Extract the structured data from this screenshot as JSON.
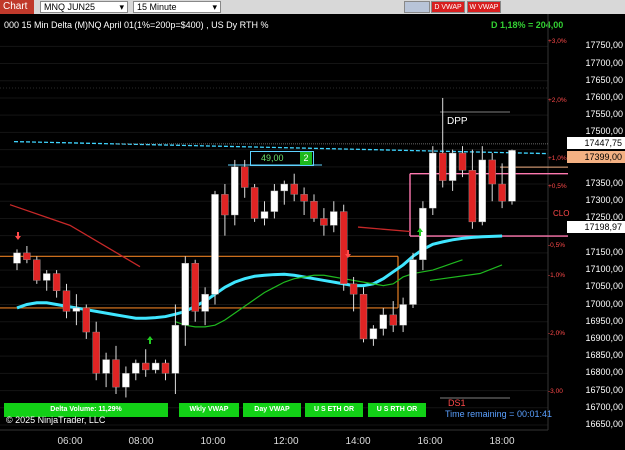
{
  "toolbar": {
    "chart_tab": "Chart",
    "instrument": "MNQ JUN25",
    "interval": "15 Minute",
    "btn_d_vwap": "D VWAP",
    "btn_w_vwap": "W VWAP",
    "colors": {
      "tab": "#c0392b",
      "toolbar_bg": "#d8d8d8"
    }
  },
  "header": {
    "title": "000 15 Min Delta (M)NQ  April 01(1%=200p=$400) , US Dy RTH %",
    "delta_stat": "D 1,18% = 204,00"
  },
  "price_axis": {
    "labels": [
      "17750,00",
      "17700,00",
      "17650,00",
      "17600,00",
      "17550,00",
      "17500,00",
      "17350,00",
      "17300,00",
      "17250,00",
      "17150,00",
      "17100,00",
      "17050,00",
      "17000,00",
      "16950,00",
      "16900,00",
      "16850,00",
      "16800,00",
      "16750,00",
      "16700,00",
      "16650,00"
    ],
    "pct_labels": [
      "+3,0%",
      "+2,0%",
      "+1,0%",
      "+0,5%",
      "-0,5%",
      "-1,0%",
      "-2,0%",
      "-3,00"
    ],
    "badge_last": "17447,75",
    "badge_prev": "17399,00",
    "badge_low": "17198,97"
  },
  "time_axis": {
    "labels": [
      "06:00",
      "08:00",
      "10:00",
      "12:00",
      "14:00",
      "16:00",
      "18:00"
    ]
  },
  "annotations": {
    "dpp": "DPP",
    "clo": "CLO",
    "ds1": "DS1",
    "delta_box_value": "49,00",
    "delta_box_count": "2"
  },
  "footer": {
    "delta_volume": "Delta Volume: 11,29%",
    "btn_wkly_vwap": "Wkly VWAP",
    "btn_day_vwap": "Day VWAP",
    "btn_us_eth": "U S ETH OR",
    "btn_us_rth": "U S RTH OR",
    "time_remaining": "Time remaining = 00:01:41",
    "copyright": "© 2025 NinjaTrader, LLC"
  },
  "chart_data": {
    "type": "candlestick",
    "instrument": "MNQ JUN25",
    "timeframe": "15 Minute",
    "y_unit": "price",
    "ylim": [
      16650,
      17780
    ],
    "last_price": 17447.75,
    "candles": [
      {
        "o": 17120,
        "h": 17160,
        "l": 17100,
        "c": 17150
      },
      {
        "o": 17150,
        "h": 17170,
        "l": 17120,
        "c": 17130
      },
      {
        "o": 17130,
        "h": 17140,
        "l": 17060,
        "c": 17070
      },
      {
        "o": 17070,
        "h": 17100,
        "l": 17040,
        "c": 17090
      },
      {
        "o": 17090,
        "h": 17100,
        "l": 17020,
        "c": 17040
      },
      {
        "o": 17040,
        "h": 17060,
        "l": 16960,
        "c": 16980
      },
      {
        "o": 16980,
        "h": 17030,
        "l": 16940,
        "c": 16990
      },
      {
        "o": 16990,
        "h": 17000,
        "l": 16900,
        "c": 16920
      },
      {
        "o": 16920,
        "h": 16950,
        "l": 16780,
        "c": 16800
      },
      {
        "o": 16800,
        "h": 16860,
        "l": 16760,
        "c": 16840
      },
      {
        "o": 16840,
        "h": 16880,
        "l": 16740,
        "c": 16760
      },
      {
        "o": 16760,
        "h": 16820,
        "l": 16730,
        "c": 16800
      },
      {
        "o": 16800,
        "h": 16840,
        "l": 16780,
        "c": 16830
      },
      {
        "o": 16830,
        "h": 16870,
        "l": 16790,
        "c": 16810
      },
      {
        "o": 16810,
        "h": 16840,
        "l": 16800,
        "c": 16830
      },
      {
        "o": 16830,
        "h": 16840,
        "l": 16780,
        "c": 16800
      },
      {
        "o": 16800,
        "h": 17000,
        "l": 16740,
        "c": 16940
      },
      {
        "o": 16940,
        "h": 17140,
        "l": 16880,
        "c": 17120
      },
      {
        "o": 17120,
        "h": 17130,
        "l": 16950,
        "c": 16980
      },
      {
        "o": 16980,
        "h": 17050,
        "l": 16940,
        "c": 17030
      },
      {
        "o": 17030,
        "h": 17330,
        "l": 17000,
        "c": 17320
      },
      {
        "o": 17320,
        "h": 17350,
        "l": 17200,
        "c": 17260
      },
      {
        "o": 17260,
        "h": 17420,
        "l": 17230,
        "c": 17400
      },
      {
        "o": 17400,
        "h": 17420,
        "l": 17310,
        "c": 17340
      },
      {
        "o": 17340,
        "h": 17350,
        "l": 17240,
        "c": 17250
      },
      {
        "o": 17250,
        "h": 17300,
        "l": 17230,
        "c": 17270
      },
      {
        "o": 17270,
        "h": 17350,
        "l": 17250,
        "c": 17330
      },
      {
        "o": 17330,
        "h": 17360,
        "l": 17290,
        "c": 17350
      },
      {
        "o": 17350,
        "h": 17380,
        "l": 17300,
        "c": 17320
      },
      {
        "o": 17320,
        "h": 17340,
        "l": 17260,
        "c": 17300
      },
      {
        "o": 17300,
        "h": 17320,
        "l": 17240,
        "c": 17250
      },
      {
        "o": 17250,
        "h": 17280,
        "l": 17200,
        "c": 17230
      },
      {
        "o": 17230,
        "h": 17300,
        "l": 17210,
        "c": 17270
      },
      {
        "o": 17270,
        "h": 17290,
        "l": 17040,
        "c": 17060
      },
      {
        "o": 17060,
        "h": 17080,
        "l": 16980,
        "c": 17030
      },
      {
        "o": 17030,
        "h": 17050,
        "l": 16890,
        "c": 16900
      },
      {
        "o": 16900,
        "h": 16940,
        "l": 16880,
        "c": 16930
      },
      {
        "o": 16930,
        "h": 16990,
        "l": 16910,
        "c": 16970
      },
      {
        "o": 16970,
        "h": 17010,
        "l": 16920,
        "c": 16940
      },
      {
        "o": 16940,
        "h": 17020,
        "l": 16920,
        "c": 17000
      },
      {
        "o": 17000,
        "h": 17150,
        "l": 16990,
        "c": 17130
      },
      {
        "o": 17130,
        "h": 17300,
        "l": 17100,
        "c": 17280
      },
      {
        "o": 17280,
        "h": 17460,
        "l": 17260,
        "c": 17440
      },
      {
        "o": 17440,
        "h": 17600,
        "l": 17340,
        "c": 17360
      },
      {
        "o": 17360,
        "h": 17450,
        "l": 17330,
        "c": 17440
      },
      {
        "o": 17440,
        "h": 17460,
        "l": 17370,
        "c": 17390
      },
      {
        "o": 17390,
        "h": 17450,
        "l": 17220,
        "c": 17240
      },
      {
        "o": 17240,
        "h": 17460,
        "l": 17230,
        "c": 17420
      },
      {
        "o": 17420,
        "h": 17440,
        "l": 17300,
        "c": 17350
      },
      {
        "o": 17350,
        "h": 17410,
        "l": 17280,
        "c": 17300
      },
      {
        "o": 17300,
        "h": 17450,
        "l": 17290,
        "c": 17447.75
      }
    ],
    "levels": {
      "orange_high": 17140,
      "orange_low": 16990,
      "pink_high": 17380,
      "pink_low": 17198.97,
      "cyan_dashed": 17450,
      "grey_high": 17455
    },
    "indicators": {
      "wkly_vwap": [
        16990,
        17000,
        17005,
        17005,
        17000,
        16995,
        16990,
        16985,
        16980,
        16975,
        16970,
        16965,
        16960,
        16960,
        16962,
        16965,
        16972,
        16980,
        16995,
        17010,
        17030,
        17050,
        17065,
        17075,
        17082,
        17085,
        17087,
        17088,
        17085,
        17080,
        17075,
        17070,
        17065,
        17060,
        17055,
        17055,
        17060,
        17075,
        17095,
        17115,
        17140,
        17160,
        17175,
        17182,
        17188,
        17192,
        17195,
        17197,
        17198,
        17198.97
      ],
      "day_vwap": [
        16950,
        16940,
        16935,
        16935,
        16940,
        16955,
        16975,
        16995,
        17015,
        17035,
        17050,
        17065,
        17075,
        17080,
        17085,
        17085,
        17080,
        17075,
        17070,
        17065,
        17060,
        17055,
        17060,
        17080,
        17090,
        17095,
        17100,
        17110,
        17120,
        17130
      ]
    }
  }
}
